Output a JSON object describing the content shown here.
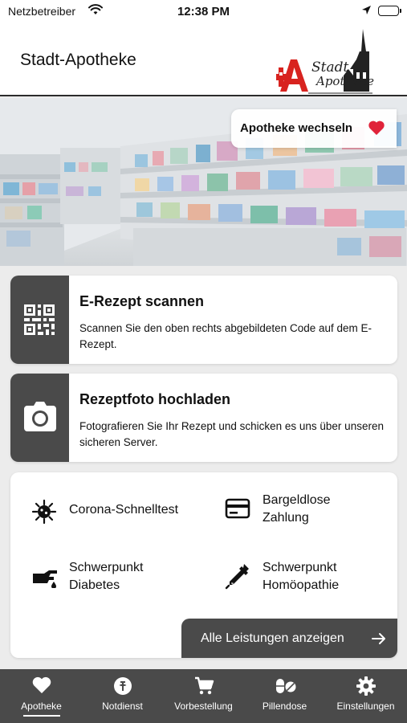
{
  "status_bar": {
    "carrier": "Netzbetreiber",
    "time": "12:38 PM"
  },
  "header": {
    "title": "Stadt-Apotheke",
    "logo_line1": "Stadt",
    "logo_line2": "Apotheke"
  },
  "hero": {
    "switch_label": "Apotheke wechseln",
    "heart_color": "#e0233a"
  },
  "cards": [
    {
      "title": "E-Rezept scannen",
      "text": "Scannen Sie den oben rechts abgebildeten Code auf dem E-Rezept.",
      "icon": "qr-code-icon"
    },
    {
      "title": "Rezeptfoto hochladen",
      "text": "Fotografieren Sie Ihr Rezept und schicken es uns über unseren sicheren Server.",
      "icon": "camera-icon"
    }
  ],
  "services": {
    "items": [
      {
        "label": "Corona-Schnelltest",
        "icon": "virus-icon"
      },
      {
        "label": "Bargeldlose Zahlung",
        "icon": "credit-card-icon"
      },
      {
        "label": "Schwerpunkt Diabetes",
        "icon": "blood-drop-hand-icon"
      },
      {
        "label": "Schwerpunkt Homöopathie",
        "icon": "pipette-icon"
      }
    ],
    "all_label": "Alle Leistungen anzeigen"
  },
  "nav": {
    "items": [
      {
        "label": "Apotheke",
        "icon": "heart-icon",
        "active": true
      },
      {
        "label": "Notdienst",
        "icon": "emergency-icon",
        "active": false
      },
      {
        "label": "Vorbestellung",
        "icon": "cart-icon",
        "active": false
      },
      {
        "label": "Pillendose",
        "icon": "pills-icon",
        "active": false
      },
      {
        "label": "Einstellungen",
        "icon": "gear-icon",
        "active": false
      }
    ]
  },
  "colors": {
    "accent_dark": "#4a4a4a",
    "logo_red": "#d8231f"
  }
}
